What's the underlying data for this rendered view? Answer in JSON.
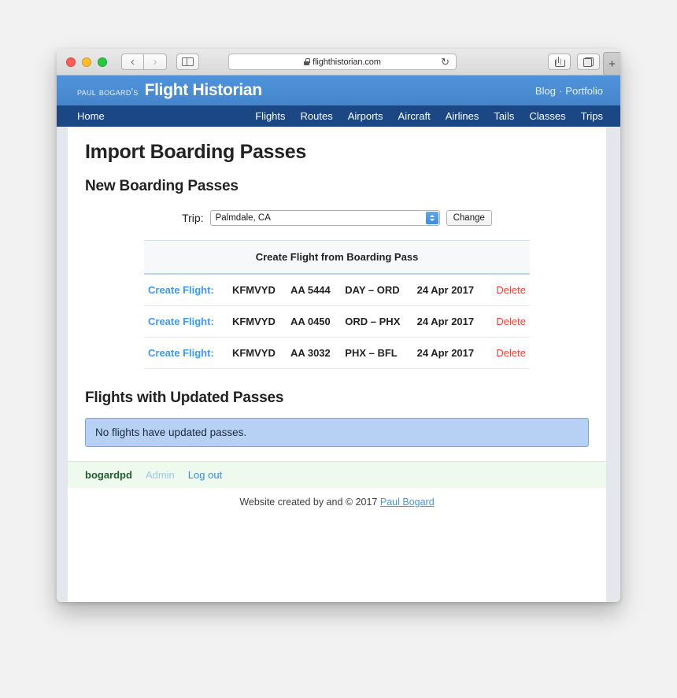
{
  "browser": {
    "url": "flighthistorian.com",
    "lock_icon": "lock-icon",
    "reload_icon": "↻",
    "back_icon": "‹",
    "forward_icon": "›",
    "newtab_label": "+"
  },
  "site_header": {
    "owner": "Paul Bogard's",
    "name": "Flight Historian",
    "links": [
      {
        "label": "Blog"
      },
      {
        "label": "Portfolio"
      }
    ],
    "link_separator": "·"
  },
  "navbar": {
    "home": "Home",
    "items": [
      {
        "label": "Flights"
      },
      {
        "label": "Routes"
      },
      {
        "label": "Airports"
      },
      {
        "label": "Aircraft"
      },
      {
        "label": "Airlines"
      },
      {
        "label": "Tails"
      },
      {
        "label": "Classes"
      },
      {
        "label": "Trips"
      }
    ]
  },
  "main": {
    "page_title": "Import Boarding Passes",
    "new_passes_title": "New Boarding Passes",
    "trip": {
      "label": "Trip:",
      "selected": "Palmdale, CA",
      "change_button": "Change"
    },
    "table": {
      "header": "Create Flight from Boarding Pass",
      "rows": [
        {
          "create": "Create Flight:",
          "ident": "KFMVYD",
          "flight": "AA 5444",
          "route": "DAY – ORD",
          "date": "24 Apr 2017",
          "delete": "Delete"
        },
        {
          "create": "Create Flight:",
          "ident": "KFMVYD",
          "flight": "AA 0450",
          "route": "ORD – PHX",
          "date": "24 Apr 2017",
          "delete": "Delete"
        },
        {
          "create": "Create Flight:",
          "ident": "KFMVYD",
          "flight": "AA 3032",
          "route": "PHX – BFL",
          "date": "24 Apr 2017",
          "delete": "Delete"
        }
      ]
    },
    "updated_title": "Flights with Updated Passes",
    "updated_alert": "No flights have updated passes."
  },
  "user_bar": {
    "username": "bogardpd",
    "admin": "Admin",
    "logout": "Log out"
  },
  "footer": {
    "text": "Website created by and © 2017",
    "author": "Paul Bogard"
  },
  "colors": {
    "header_blue": "#4a8bd2",
    "nav_navy": "#1b4785",
    "link_blue": "#3b9af5",
    "delete_red": "#f6402c",
    "alert_blue": "#b7d1f5",
    "user_green": "#eefaee"
  }
}
